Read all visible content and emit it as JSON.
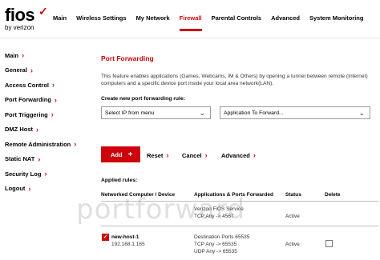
{
  "brand": {
    "name": "fios",
    "mark": "✓",
    "sub": "by verizon"
  },
  "nav": [
    {
      "label": "Main",
      "active": false
    },
    {
      "label": "Wireless Settings",
      "active": false
    },
    {
      "label": "My Network",
      "active": false
    },
    {
      "label": "Firewall",
      "active": true
    },
    {
      "label": "Parental Controls",
      "active": false
    },
    {
      "label": "Advanced",
      "active": false
    },
    {
      "label": "System Monitoring",
      "active": false
    }
  ],
  "sidebar": [
    {
      "label": "Main"
    },
    {
      "label": "General"
    },
    {
      "label": "Access Control"
    },
    {
      "label": "Port Forwarding"
    },
    {
      "label": "Port Triggering"
    },
    {
      "label": "DMZ Host"
    },
    {
      "label": "Remote Administration"
    },
    {
      "label": "Static NAT"
    },
    {
      "label": "Security Log"
    },
    {
      "label": "Logout"
    }
  ],
  "page": {
    "title": "Port Forwarding",
    "description": "This feature enables applications (Games, Webcams, IM & Others) by opening a tunnel between remote (Internet) computers and a specific device port inside your local area network(LAN).",
    "create_label": "Create new port forwarding rule:",
    "ip_select": "Select IP from menu",
    "app_select": "Application To Forward...",
    "add_label": "Add",
    "reset_label": "Reset",
    "cancel_label": "Cancel",
    "advanced_label": "Advanced",
    "applied_label": "Applied rules:"
  },
  "table": {
    "headers": [
      "Networked Computer / Device",
      "Applications & Ports Forwarded",
      "Status",
      "Delete"
    ],
    "rows": [
      {
        "device": "",
        "device_ip": "",
        "app1": "Verizon FiOS Service",
        "app2": "TCP Any -> 4567",
        "app3": "",
        "status": "Active",
        "checked": false
      },
      {
        "device": "new-host-1",
        "device_ip": "192.168.1.165",
        "app1": "Destination Ports 65535",
        "app2": "TCP Any -> 65535",
        "app3": "UDP Any -> 65535",
        "status": "Active",
        "checked": true
      }
    ]
  },
  "watermark": "portforward",
  "colors": {
    "accent": "#cd040b"
  }
}
